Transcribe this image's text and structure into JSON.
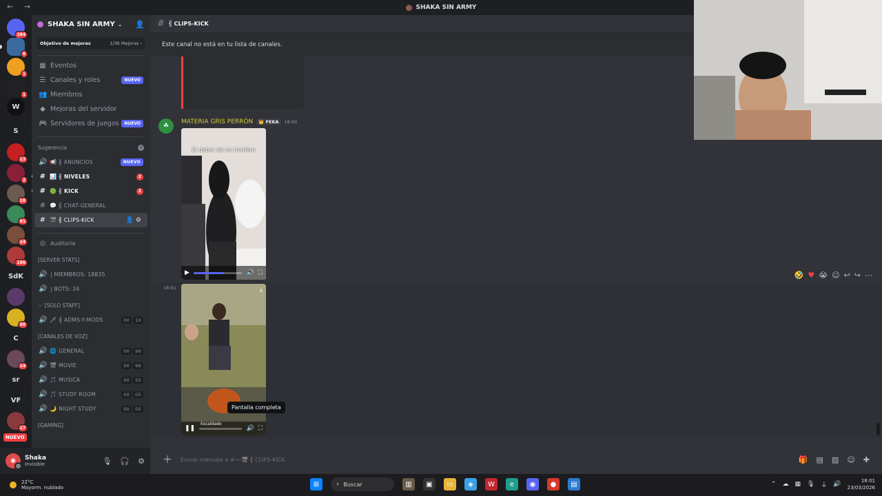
{
  "window": {
    "title": "SHAKA SIN ARMY",
    "nav_arrows": "← →"
  },
  "rail": {
    "servers": [
      {
        "label": "",
        "badge": "284",
        "color": "#5865f2"
      },
      {
        "label": "",
        "badge": "6",
        "color": "#3b6aa0"
      },
      {
        "label": "",
        "badge": "1",
        "color": "#f0a020"
      },
      {
        "label": "",
        "badge": "1",
        "color": "#222222"
      },
      {
        "label": "W",
        "badge": "",
        "color": "#111111"
      },
      {
        "label": "S",
        "badge": "",
        "color": "#1e1f22"
      },
      {
        "label": "",
        "badge": "13",
        "color": "#c52020"
      },
      {
        "label": "",
        "badge": "2",
        "color": "#8a1f3a"
      },
      {
        "label": "",
        "badge": "18",
        "color": "#6d5a4e"
      },
      {
        "label": "",
        "badge": "91",
        "color": "#3a8a5a"
      },
      {
        "label": "",
        "badge": "24",
        "color": "#7a4e3a"
      },
      {
        "label": "",
        "badge": "186",
        "color": "#b03a3a"
      },
      {
        "label": "SdK",
        "badge": "",
        "color": "#1e1f22"
      },
      {
        "label": "",
        "badge": "",
        "color": "#5a3a6a"
      },
      {
        "label": "",
        "badge": "90",
        "color": "#d8b020"
      },
      {
        "label": "C",
        "badge": "",
        "color": "#1e1f22"
      },
      {
        "label": "",
        "badge": "14",
        "color": "#6a4a5a"
      },
      {
        "label": "sr",
        "badge": "",
        "color": "#1e1f22"
      },
      {
        "label": "VF",
        "badge": "",
        "color": "#1e1f22"
      },
      {
        "label": "",
        "badge": "17",
        "color": "#8a3a3a"
      }
    ],
    "new_badge": "NUEVO"
  },
  "server": {
    "name": "SHAKA SIN ARMY"
  },
  "boost": {
    "label": "Objetivo de mejoras",
    "progress": "1/36 Mejoras"
  },
  "nav_items": [
    {
      "icon": "▦",
      "label": "Eventos",
      "pill": ""
    },
    {
      "icon": "☰",
      "label": "Canales y roles",
      "pill": "NUEVO"
    },
    {
      "icon": "👥",
      "label": "Miembros",
      "pill": ""
    },
    {
      "icon": "◆",
      "label": "Mejoras del servidor",
      "pill": ""
    },
    {
      "icon": "🎮",
      "label": "Servidores de juegos",
      "pill": "NUEVO"
    }
  ],
  "suggestion": {
    "label": "Sugerencia"
  },
  "channels": [
    {
      "icon": "🔊",
      "emoji": "📢",
      "label": "╢ ANUNCIOS",
      "pill": "NUEVO",
      "count": "",
      "unread": false,
      "active": false
    },
    {
      "icon": "#",
      "emoji": "📊",
      "label": "╢ NIVELES",
      "pill": "",
      "count": "2",
      "unread": true,
      "active": false
    },
    {
      "icon": "#",
      "emoji": "🟢",
      "label": "╢ KICK",
      "pill": "",
      "count": "2",
      "unread": true,
      "active": false
    },
    {
      "icon": "#",
      "emoji": "💬",
      "label": "╢ CHAT-GENERAL",
      "pill": "",
      "count": "",
      "unread": false,
      "active": false
    },
    {
      "icon": "#",
      "emoji": "🎬",
      "label": "╢ CLIPS-KICK",
      "pill": "",
      "count": "",
      "unread": false,
      "active": true
    }
  ],
  "audit": {
    "label": "Auditoria"
  },
  "stats_category": "[SERVER STATS]",
  "stats": [
    {
      "label": "| MIEMBROS: 18835"
    },
    {
      "label": "| BOTS: 24"
    }
  ],
  "staff_category": "[SOLO STAFF]",
  "staff_channel": {
    "label": "╢ ADMS-Y-MODS",
    "users": "00",
    "limit": "10"
  },
  "voice_category": "[CANALES DE VOZ]",
  "voice_channels": [
    {
      "emoji": "🌐",
      "label": "GENERAL",
      "users": "00",
      "limit": "99"
    },
    {
      "emoji": "🎬",
      "label": "MOVIE",
      "users": "00",
      "limit": "99"
    },
    {
      "emoji": "🎵",
      "label": "MUSICA",
      "users": "00",
      "limit": "50"
    },
    {
      "emoji": "🎵",
      "label": "STUDY ROOM",
      "users": "00",
      "limit": "05"
    },
    {
      "emoji": "🌙",
      "label": "NIGHT STUDY",
      "users": "00",
      "limit": "05"
    }
  ],
  "gaming_category": "[GAMING]",
  "user": {
    "name": "Shaka",
    "status": "Invisible"
  },
  "channel_header": {
    "name": "╢ CLIPS-KICK"
  },
  "notice": "Este canal no está en tu lista de canales.",
  "message": {
    "author": "MATERIA GRIS PERRÓN",
    "tag": "FEKA",
    "time": "18:00"
  },
  "video1": {
    "caption": "El deber de un hombre",
    "progress": 0.62
  },
  "second_message": {
    "time": "18:01"
  },
  "video2": {
    "caption": "Escaldado"
  },
  "tooltip": "Pantalla completa",
  "composer": {
    "placeholder": "Enviar mensaje a #──🎬 ╢ CLIPS-KICK"
  },
  "taskbar": {
    "weather_temp": "22°C",
    "weather_desc": "Mayorm. nublado",
    "search": "Buscar",
    "time": "18:01",
    "date": "23/03/2026"
  }
}
